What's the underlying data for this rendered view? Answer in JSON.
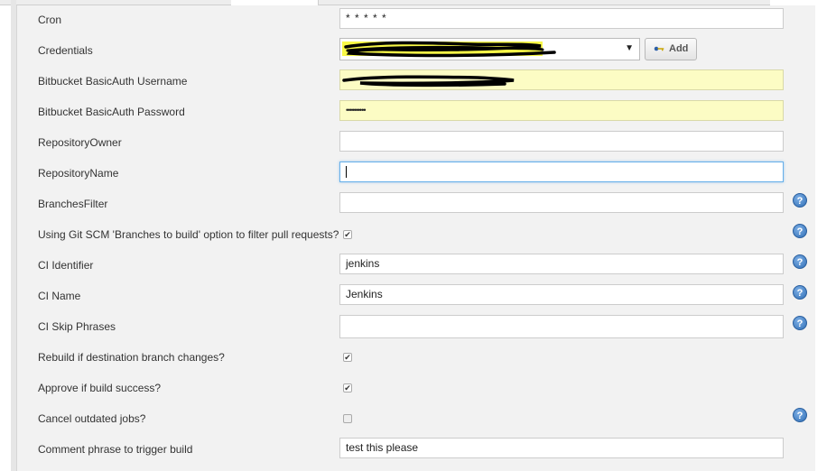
{
  "form": {
    "fields": [
      {
        "id": "cron",
        "label": "Cron",
        "value": "* * * * *"
      },
      {
        "id": "credentials",
        "label": "Credentials",
        "add_label": "Add"
      },
      {
        "id": "bb-username",
        "label": "Bitbucket BasicAuth Username"
      },
      {
        "id": "bb-password",
        "label": "Bitbucket BasicAuth Password",
        "value": "••••••••••"
      },
      {
        "id": "repo-owner",
        "label": "RepositoryOwner",
        "value": ""
      },
      {
        "id": "repo-name",
        "label": "RepositoryName",
        "value": ""
      },
      {
        "id": "branches-filter",
        "label": "BranchesFilter",
        "value": ""
      },
      {
        "id": "git-scm-filter",
        "label": "Using Git SCM 'Branches to build' option to filter pull requests?",
        "checked": true
      },
      {
        "id": "ci-identifier",
        "label": "CI Identifier",
        "value": "jenkins"
      },
      {
        "id": "ci-name",
        "label": "CI Name",
        "value": "Jenkins"
      },
      {
        "id": "ci-skip",
        "label": "CI Skip Phrases",
        "value": ""
      },
      {
        "id": "rebuild",
        "label": "Rebuild if destination branch changes?",
        "checked": true
      },
      {
        "id": "approve",
        "label": "Approve if build success?",
        "checked": true
      },
      {
        "id": "cancel",
        "label": "Cancel outdated jobs?",
        "checked": false
      },
      {
        "id": "comment-phrase",
        "label": "Comment phrase to trigger build",
        "value": "test this please"
      }
    ],
    "checkmark": "✔",
    "help_glyph": "?"
  },
  "colors": {
    "autofill_yellow": "#fcfcc4",
    "help_blue": "#2f6eb5",
    "panel_bg": "#f2f2f2"
  },
  "icons": [
    "key-icon",
    "dropdown-arrow-icon",
    "help-icon"
  ]
}
